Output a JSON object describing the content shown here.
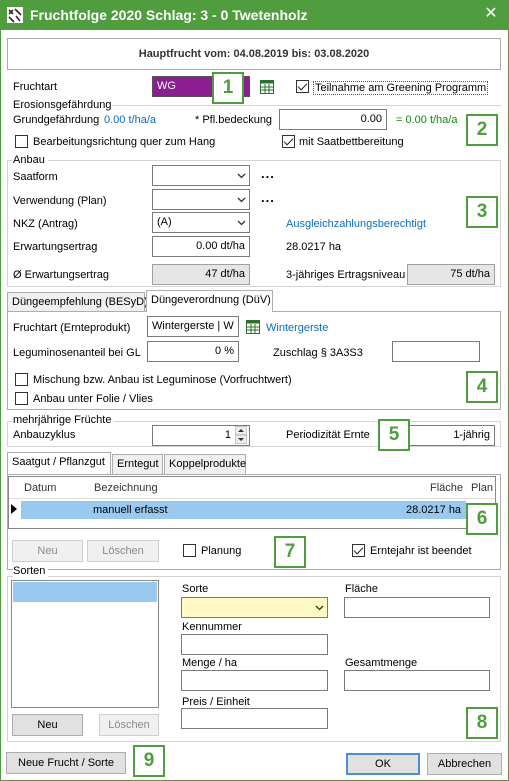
{
  "window": {
    "title": "Fruchtfolge 2020 Schlag: 3 - 0 Twetenholz",
    "close_glyph": "✕"
  },
  "header": {
    "hauptfrucht": "Hauptfrucht vom: 04.08.2019 bis: 03.08.2020"
  },
  "fruchtart": {
    "label": "Fruchtart",
    "value": "WG",
    "value_bg": "#8b1f8f",
    "greening_label": "Teilnahme am Greening Programm",
    "greening_checked": true
  },
  "erosion": {
    "group_label": "Erosionsgefährdung",
    "grund_label": "Grundgefährdung",
    "grund_value": "0.00 t/ha/a",
    "pfl_label": "* Pfl.bedeckung",
    "pfl_value": "0.00",
    "result_value": "= 0.00 t/ha/a",
    "quer_label": "Bearbeitungsrichtung quer zum Hang",
    "quer_checked": false,
    "saatbett_label": "mit Saatbettbereitung",
    "saatbett_checked": true
  },
  "anbau": {
    "group_label": "Anbau",
    "saatform_label": "Saatform",
    "saatform_value": "",
    "verwendung_label": "Verwendung (Plan)",
    "verwendung_value": "",
    "ellipsis": "...",
    "nkz_label": "NKZ  (Antrag)",
    "nkz_value": "(A)",
    "ausgleich_label": "Ausgleichzahlungsberechtigt",
    "ertrag_label": "Erwartungsertrag",
    "ertrag_value": "0.00 dt/ha",
    "flaeche_value": "28.0217 ha",
    "avg_ertrag_label": "Ø Erwartungsertrag",
    "avg_ertrag_value": "47 dt/ha",
    "niveau_label": "3-jähriges Ertragsniveau",
    "niveau_value": "75 dt/ha"
  },
  "duenge_tabs": [
    {
      "label": "Düngeempfehlung (BESyD)",
      "active": false
    },
    {
      "label": "Düngeverordnung (DüV)",
      "active": true
    }
  ],
  "duev": {
    "ernte_label": "Fruchtart (Ernteprodukt)",
    "ernte_value": "Wintergerste | W",
    "ernte_link": "Wintergerste",
    "legum_label": "Leguminosenanteil bei GL",
    "legum_value": "0 %",
    "zuschlag_label": "Zuschlag § 3A3S3",
    "zuschlag_value": "",
    "mischung_label": "Mischung bzw. Anbau ist Leguminose (Vorfruchtwert)",
    "mischung_checked": false,
    "folie_label": "Anbau unter Folie / Vlies",
    "folie_checked": false
  },
  "mehrjaehrig": {
    "group_label": "mehrjährige Früchte",
    "zyklus_label": "Anbauzyklus",
    "zyklus_value": "1",
    "periodizitaet_label": "Periodizität Ernte",
    "periodizitaet_value": "1-jährig"
  },
  "saat_tabs": [
    {
      "label": "Saatgut / Pflanzgut",
      "active": true
    },
    {
      "label": "Erntegut",
      "active": false
    },
    {
      "label": "Koppelprodukte",
      "active": false
    }
  ],
  "saat_table": {
    "columns": [
      "Datum",
      "Bezeichnung",
      "Fläche",
      "Plan"
    ],
    "rows": [
      {
        "datum": "",
        "bezeichnung": "manuell erfasst",
        "flaeche": "28.0217 ha",
        "plan": ""
      }
    ]
  },
  "saat_buttons": {
    "neu": "Neu",
    "loeschen": "Löschen",
    "planung_label": "Planung",
    "planung_checked": false,
    "erntejahr_label": "Erntejahr ist beendet",
    "erntejahr_checked": true
  },
  "sorten": {
    "group_label": "Sorten",
    "sorte_label": "Sorte",
    "sorte_value": "",
    "flaeche_label": "Fläche",
    "flaeche_value": "",
    "kennummer_label": "Kennummer",
    "kennummer_value": "",
    "menge_label": "Menge / ha",
    "menge_value": "",
    "gesamtmenge_label": "Gesamtmenge",
    "gesamtmenge_value": "",
    "preis_label": "Preis / Einheit",
    "preis_value": "",
    "neu": "Neu",
    "loeschen": "Löschen"
  },
  "footer": {
    "neue_frucht": "Neue Frucht / Sorte",
    "ok": "OK",
    "abbrechen": "Abbrechen"
  },
  "callouts": [
    "1",
    "2",
    "3",
    "4",
    "5",
    "6",
    "7",
    "8",
    "9"
  ],
  "colors": {
    "titlebar": "#4f9d3f",
    "callout": "#4f9d3f",
    "link": "#0b6cc4",
    "selection": "#99c9ef",
    "sorte_input_bg": "#fff9c4"
  },
  "icons": [
    "app-icon",
    "close-icon",
    "grid-icon",
    "chevron-down-icon",
    "spin-up-icon",
    "spin-down-icon",
    "row-pointer-icon"
  ]
}
